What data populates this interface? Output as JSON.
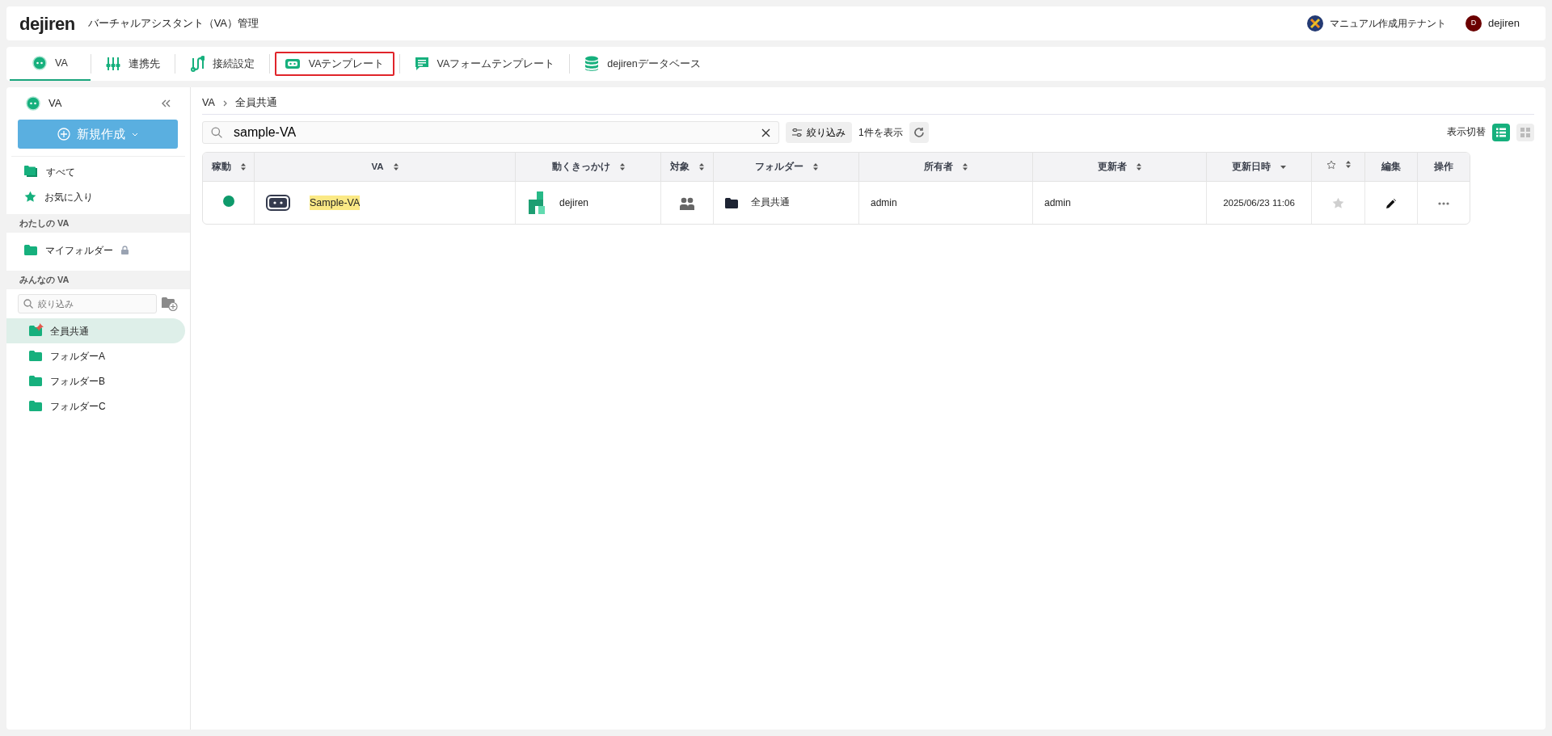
{
  "header": {
    "logo": "dejiren",
    "title": "バーチャルアシスタント（VA）管理",
    "tenant": "マニュアル作成用テナント",
    "user": {
      "initial": "D",
      "name": "dejiren"
    }
  },
  "tabs": [
    {
      "label": "VA",
      "kind": "va",
      "selected": true,
      "highlighted": false
    },
    {
      "label": "連携先",
      "kind": "sliders",
      "selected": false,
      "highlighted": false
    },
    {
      "label": "接続設定",
      "kind": "connect",
      "selected": false,
      "highlighted": false
    },
    {
      "label": "VAテンプレート",
      "kind": "robot",
      "selected": false,
      "highlighted": true
    },
    {
      "label": "VAフォームテンプレート",
      "kind": "form",
      "selected": false,
      "highlighted": false
    },
    {
      "label": "dejirenデータベース",
      "kind": "database",
      "selected": false,
      "highlighted": false
    }
  ],
  "sidebar": {
    "title": "VA",
    "new_button": "新規作成",
    "nav": [
      {
        "label": "すべて",
        "kind": "folders"
      },
      {
        "label": "お気に入り",
        "kind": "star"
      }
    ],
    "my_section": {
      "heading": "わたしの VA",
      "items": [
        {
          "label": "マイフォルダー",
          "locked": true
        }
      ]
    },
    "shared_section": {
      "heading": "みんなの VA",
      "filter": {
        "placeholder": "絞り込み"
      },
      "folders": [
        {
          "label": "全員共通",
          "selected": true,
          "pinned": true
        },
        {
          "label": "フォルダーA",
          "selected": false,
          "pinned": false
        },
        {
          "label": "フォルダーB",
          "selected": false,
          "pinned": false
        },
        {
          "label": "フォルダーC",
          "selected": false,
          "pinned": false
        }
      ]
    }
  },
  "breadcrumb": [
    "VA",
    "全員共通"
  ],
  "toolbar": {
    "search": {
      "value": "sample-VA"
    },
    "filter_button": "絞り込み",
    "count": "1件を表示",
    "view_label": "表示切替",
    "views": [
      {
        "kind": "list",
        "selected": true
      },
      {
        "kind": "grid",
        "selected": false
      }
    ]
  },
  "table": {
    "columns": [
      {
        "label": "稼動",
        "sortable": true,
        "sorted_desc": false
      },
      {
        "label": "VA",
        "sortable": true,
        "sorted_desc": false
      },
      {
        "label": "動くきっかけ",
        "sortable": true,
        "sorted_desc": false
      },
      {
        "label": "対象",
        "sortable": true,
        "sorted_desc": false
      },
      {
        "label": "フォルダー",
        "sortable": true,
        "sorted_desc": false
      },
      {
        "label": "所有者",
        "sortable": true,
        "sorted_desc": false
      },
      {
        "label": "更新者",
        "sortable": true,
        "sorted_desc": false
      },
      {
        "label": "更新日時",
        "sortable": true,
        "sorted_desc": true
      },
      {
        "kind": "star",
        "sortable": true,
        "sorted_desc": false
      },
      {
        "label": "編集",
        "sortable": false
      },
      {
        "label": "操作",
        "sortable": false
      }
    ],
    "rows": [
      {
        "active": true,
        "name": "Sample-VA",
        "match": true,
        "trigger": "dejiren",
        "folder": "全員共通",
        "owner": "admin",
        "updater": "admin",
        "updated": "2025/06/23 11:06",
        "favorite": false
      }
    ]
  }
}
